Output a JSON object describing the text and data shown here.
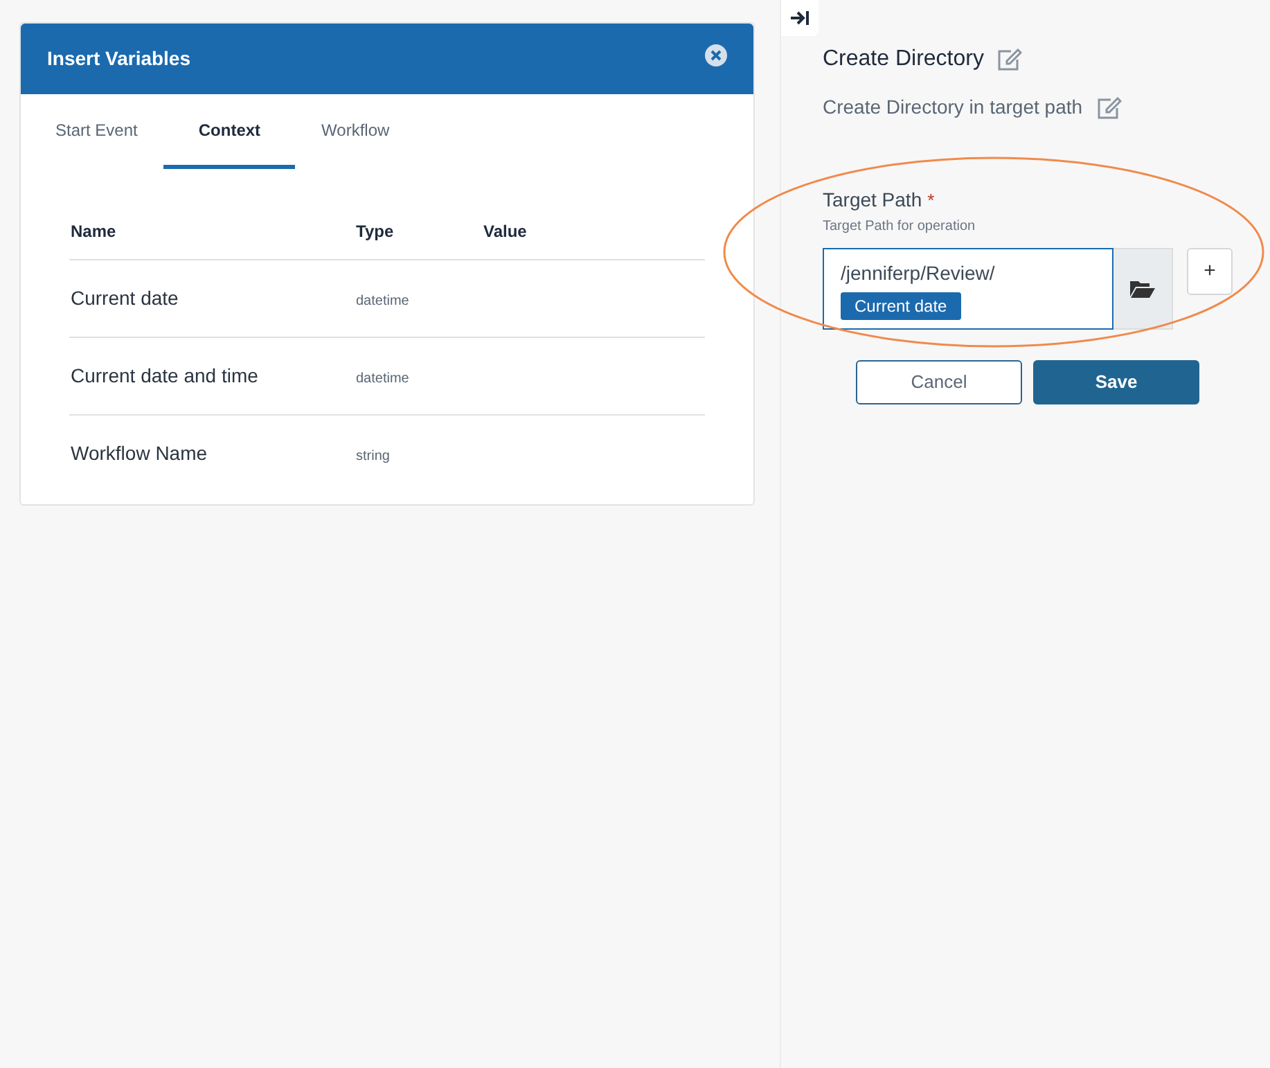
{
  "dialog": {
    "title": "Insert Variables",
    "tabs": [
      {
        "label": "Start Event",
        "selected": false
      },
      {
        "label": "Context",
        "selected": true
      },
      {
        "label": "Workflow",
        "selected": false
      }
    ],
    "table": {
      "columns": [
        "Name",
        "Type",
        "Value"
      ],
      "rows": [
        {
          "name": "Current date",
          "type": "datetime"
        },
        {
          "name": "Current date and time",
          "type": "datetime"
        },
        {
          "name": "Workflow Name",
          "type": "string"
        }
      ]
    }
  },
  "panel": {
    "title": "Create Directory",
    "description": "Create Directory in target path",
    "field": {
      "label": "Target Path",
      "required_mark": "*",
      "help": "Target Path for operation",
      "value": "/jenniferp/Review/",
      "tokens": [
        "Current date"
      ],
      "add_button": "+"
    },
    "buttons": [
      {
        "label": "Cancel",
        "kind": "secondary"
      },
      {
        "label": "Save",
        "kind": "primary"
      }
    ]
  }
}
